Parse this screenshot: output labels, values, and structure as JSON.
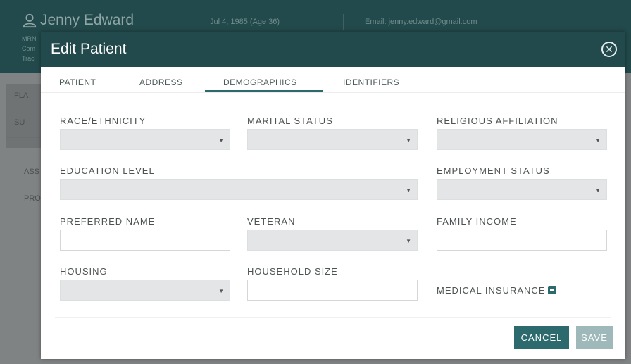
{
  "background": {
    "patient_name": "Jenny Edward",
    "dob": "Jul 4, 1985 (Age 36)",
    "email": "Email: jenny.edward@gmail.com",
    "mrn_label": "MRN",
    "com_label": "Com",
    "trac_label": "Trac",
    "side_tabs": [
      "FLA",
      "SU"
    ],
    "side_items": [
      "ASS",
      "PRO"
    ]
  },
  "modal": {
    "title": "Edit Patient",
    "tabs": [
      {
        "label": "PATIENT"
      },
      {
        "label": "ADDRESS"
      },
      {
        "label": "DEMOGRAPHICS"
      },
      {
        "label": "IDENTIFIERS"
      }
    ],
    "active_tab": "DEMOGRAPHICS",
    "fields": {
      "race": {
        "label": "RACE/ETHNICITY",
        "value": ""
      },
      "marital": {
        "label": "MARITAL STATUS",
        "value": ""
      },
      "religion": {
        "label": "RELIGIOUS AFFILIATION",
        "value": ""
      },
      "education": {
        "label": "EDUCATION LEVEL",
        "value": ""
      },
      "employment": {
        "label": "EMPLOYMENT STATUS",
        "value": ""
      },
      "preferred_name": {
        "label": "PREFERRED NAME",
        "value": ""
      },
      "veteran": {
        "label": "VETERAN",
        "value": ""
      },
      "family_income": {
        "label": "FAMILY INCOME",
        "value": ""
      },
      "housing": {
        "label": "HOUSING",
        "value": ""
      },
      "household_size": {
        "label": "HOUSEHOLD SIZE",
        "value": ""
      },
      "medical_insurance": {
        "label": "MEDICAL INSURANCE"
      }
    },
    "buttons": {
      "cancel": "CANCEL",
      "save": "SAVE"
    }
  },
  "colors": {
    "primary": "#2d6a6d",
    "header": "#22494b",
    "save_disabled": "#9fb9bb"
  }
}
